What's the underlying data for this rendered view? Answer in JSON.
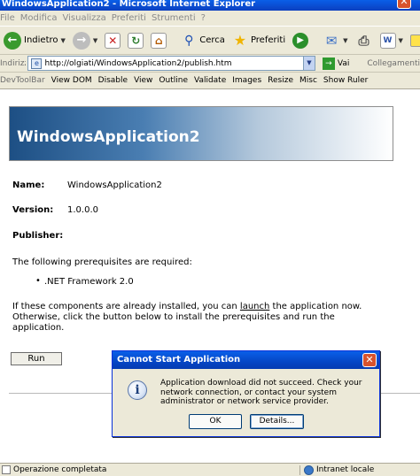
{
  "window": {
    "title": "WindowsApplication2 - Microsoft Internet Explorer"
  },
  "menu": {
    "items": [
      "File",
      "Modifica",
      "Visualizza",
      "Preferiti",
      "Strumenti",
      "?"
    ]
  },
  "toolbar": {
    "back_label": "Indietro",
    "search_label": "Cerca",
    "favorites_label": "Preferiti"
  },
  "address": {
    "label": "Indirizzo",
    "url": "http://olgiati/WindowsApplication2/publish.htm",
    "go_label": "Vai",
    "links_label": "Collegamenti"
  },
  "devtoolbar": {
    "items": [
      "DevToolBar",
      "View DOM",
      "Disable",
      "View",
      "Outline",
      "Validate",
      "Images",
      "Resize",
      "Misc",
      "Show Ruler"
    ]
  },
  "page": {
    "heading": "WindowsApplication2",
    "name_label": "Name:",
    "name_value": "WindowsApplication2",
    "version_label": "Version:",
    "version_value": "1.0.0.0",
    "publisher_label": "Publisher:",
    "prereq_text": "The following prerequisites are required:",
    "prereq_item": ".NET Framework 2.0",
    "install_text_1": "If these components are already installed, you can ",
    "launch_link": "launch",
    "install_text_2": " the application now. Otherwise, click the button below to install the prerequisites and run the application.",
    "run_button": "Run"
  },
  "dialog": {
    "title": "Cannot Start Application",
    "message": "Application download did not succeed. Check your network connection, or contact your system administrator or network service provider.",
    "ok_label": "OK",
    "details_label": "Details..."
  },
  "status": {
    "text": "Operazione completata",
    "zone": "Intranet locale"
  }
}
